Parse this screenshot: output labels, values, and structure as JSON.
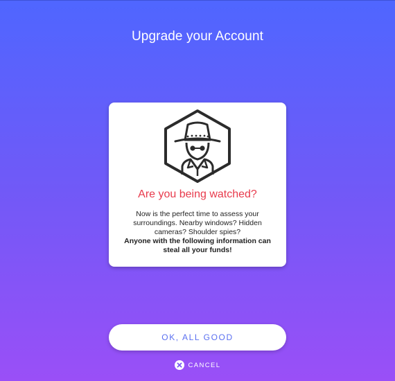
{
  "header": {
    "title": "Upgrade your Account"
  },
  "card": {
    "icon": "spy-icon",
    "heading": "Are you being watched?",
    "body": "Now is the perfect time to assess your surroundings. Nearby windows? Hidden cameras? Shoulder spies?",
    "emphasis": "Anyone with the following information can steal all your funds!"
  },
  "actions": {
    "ok_label": "OK, ALL GOOD",
    "cancel_label": "CANCEL",
    "cancel_icon": "close-circle-icon"
  },
  "colors": {
    "gradient_top": "#4f66ff",
    "gradient_bottom": "#9a4ff7",
    "warning": "#e83a4c",
    "button_text": "#5a6ff0"
  }
}
